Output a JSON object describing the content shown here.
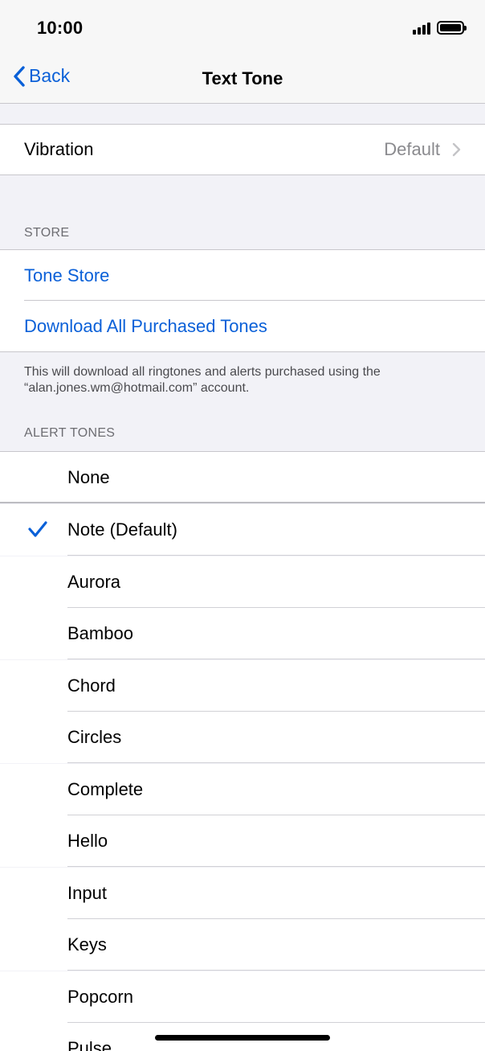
{
  "status_bar": {
    "time": "10:00"
  },
  "nav": {
    "back_label": "Back",
    "title": "Text Tone"
  },
  "vibration": {
    "label": "Vibration",
    "value": "Default"
  },
  "store": {
    "header": "STORE",
    "tone_store": "Tone Store",
    "download_all": "Download All Purchased Tones",
    "footer": "This will download all ringtones and alerts purchased using the “alan.jones.wm@hotmail.com” account."
  },
  "alert_tones": {
    "header": "ALERT TONES",
    "none": "None",
    "selected_index": 0,
    "items": [
      "Note (Default)",
      "Aurora",
      "Bamboo",
      "Chord",
      "Circles",
      "Complete",
      "Hello",
      "Input",
      "Keys",
      "Popcorn",
      "Pulse"
    ]
  },
  "colors": {
    "accent": "#0a60d8",
    "grouped_background": "#f2f2f7",
    "separator": "#c8c7cc"
  },
  "icons": {
    "back": "chevron-left-icon",
    "disclosure": "chevron-right-icon",
    "selected": "checkmark-icon",
    "signal": "cellular-signal-icon",
    "battery": "battery-icon"
  }
}
